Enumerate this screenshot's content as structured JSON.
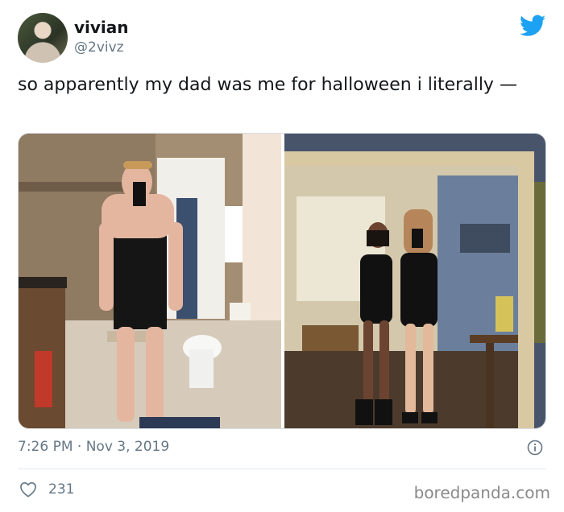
{
  "user": {
    "name": "vivian",
    "handle": "@2vivz"
  },
  "tweet": {
    "text": "so apparently my dad was me for halloween i literally —",
    "timestamp": "7:26 PM · Nov 3, 2019",
    "likes": "231"
  },
  "icons": {
    "logo": "twitter-bird-icon",
    "info": "info-icon",
    "like": "heart-icon"
  },
  "colors": {
    "twitter_blue": "#1da1f2",
    "secondary_text": "#657786"
  },
  "watermark": "boredpanda.com"
}
